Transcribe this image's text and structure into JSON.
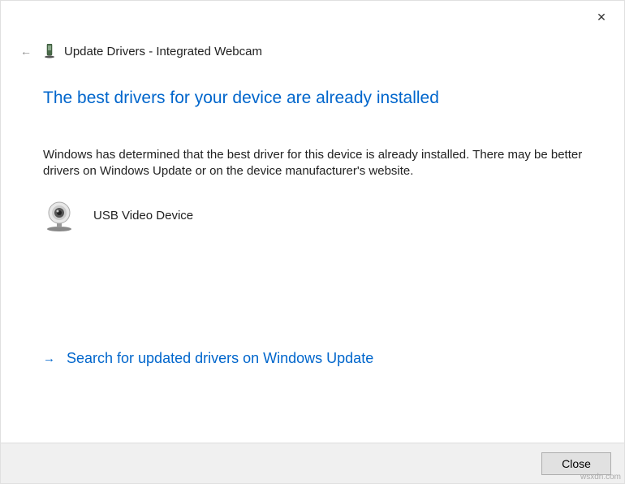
{
  "window": {
    "close_x": "✕"
  },
  "header": {
    "back_arrow": "←",
    "title": "Update Drivers - Integrated Webcam"
  },
  "main": {
    "heading": "The best drivers for your device are already installed",
    "description": "Windows has determined that the best driver for this device is already installed. There may be better drivers on Windows Update or on the device manufacturer's website.",
    "device_name": "USB Video Device"
  },
  "link": {
    "arrow": "→",
    "label": "Search for updated drivers on Windows Update"
  },
  "footer": {
    "close_label": "Close"
  },
  "watermark": "wsxdn.com"
}
